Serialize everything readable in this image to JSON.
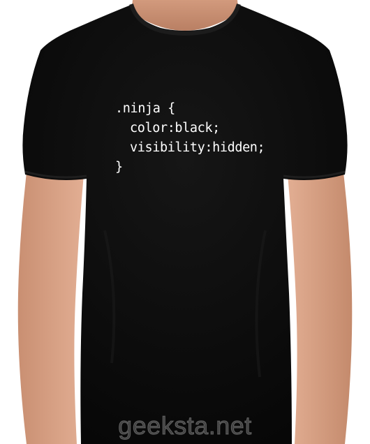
{
  "shirt": {
    "color": "#0d0d0d",
    "skin_color": "#d9a487",
    "background_color": "#ffffff",
    "print_color": "#ffffff",
    "print_lines": [
      ".ninja {",
      "color:black;",
      "visibility:hidden;",
      "}"
    ]
  },
  "watermark": {
    "text": "geeksta.net"
  }
}
